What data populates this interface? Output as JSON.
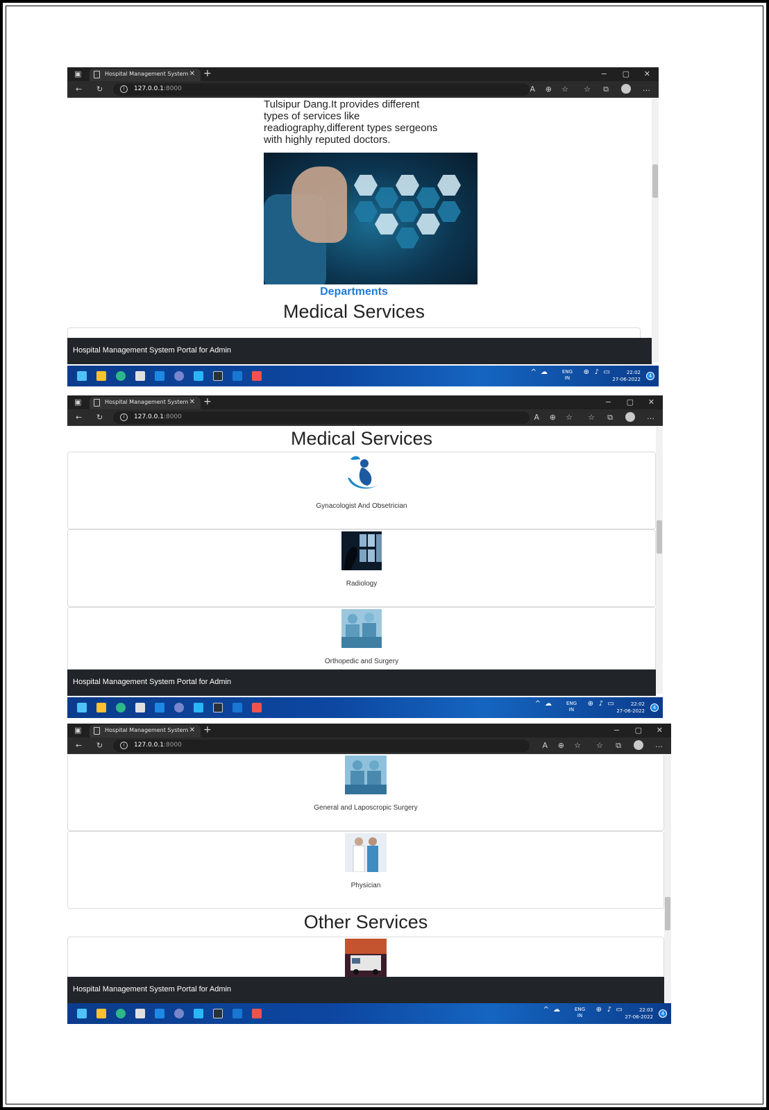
{
  "browser": {
    "tab_title": "Hospital Management System",
    "url_host": "127.0.0.1",
    "url_port": ":8000"
  },
  "screens": [
    {
      "about_text": "Tulsipur Dang.It provides different types of services like readiography,different types sergeons with highly reputed doctors.",
      "departments_link": "Departments",
      "section_title": "Medical Services",
      "footer": "Hospital Management System Portal for Admin",
      "time": "22:02",
      "date": "27-06-2022"
    },
    {
      "section_title": "Medical Services",
      "cards": [
        "Gynacologist And Obsetrician",
        "Radiology",
        "Orthopedic and Surgery"
      ],
      "footer": "Hospital Management System Portal for Admin",
      "time": "22:02",
      "date": "27-06-2022"
    },
    {
      "cards": [
        "General and Laposcropic Surgery",
        "Physician"
      ],
      "section_title": "Other Services",
      "footer": "Hospital Management System Portal for Admin",
      "time": "22:03",
      "date": "27-06-2022"
    }
  ],
  "taskbar": {
    "lang": "ENG",
    "region": "IN",
    "notification_count": "4"
  }
}
